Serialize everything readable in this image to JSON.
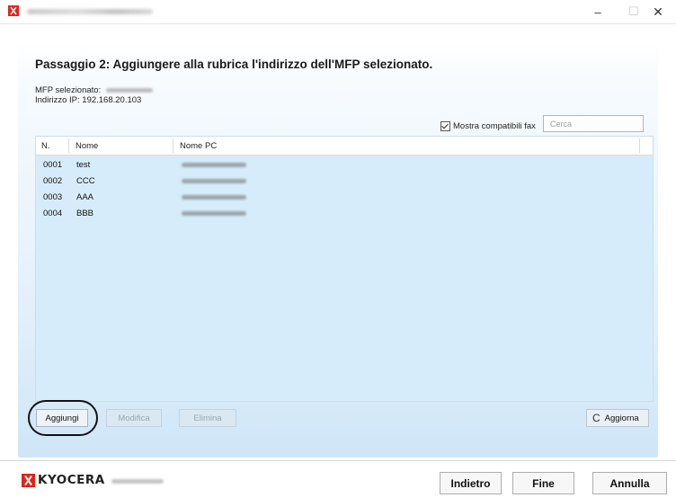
{
  "window": {
    "minimize_glyph": "–",
    "maximize_glyph": "☐",
    "close_glyph": "✕"
  },
  "wizard": {
    "title": "Passaggio 2: Aggiungere alla rubrica l'indirizzo dell'MFP selezionato.",
    "mfp_label": "MFP selezionato:",
    "ip_label": "Indirizzo IP:",
    "ip_value": "192.168.20.103"
  },
  "filter": {
    "fax_compatible_label": "Mostra compatibili fax",
    "fax_compatible_checked": true,
    "search_placeholder": "Cerca"
  },
  "table": {
    "columns": [
      "N.",
      "Nome",
      "Nome PC"
    ],
    "rows": [
      {
        "num": "0001",
        "name": "test"
      },
      {
        "num": "0002",
        "name": "CCC"
      },
      {
        "num": "0003",
        "name": "AAA"
      },
      {
        "num": "0004",
        "name": "BBB"
      }
    ]
  },
  "actions": {
    "add": "Aggiungi",
    "edit": "Modifica",
    "delete": "Elimina",
    "refresh": "Aggiorna",
    "refresh_icon": "C"
  },
  "footer": {
    "brand": "KYOCERA",
    "back": "Indietro",
    "finish": "Fine",
    "cancel": "Annulla"
  },
  "colors": {
    "brand_red": "#e2231a",
    "panel_blue": "#d7ecfa"
  }
}
